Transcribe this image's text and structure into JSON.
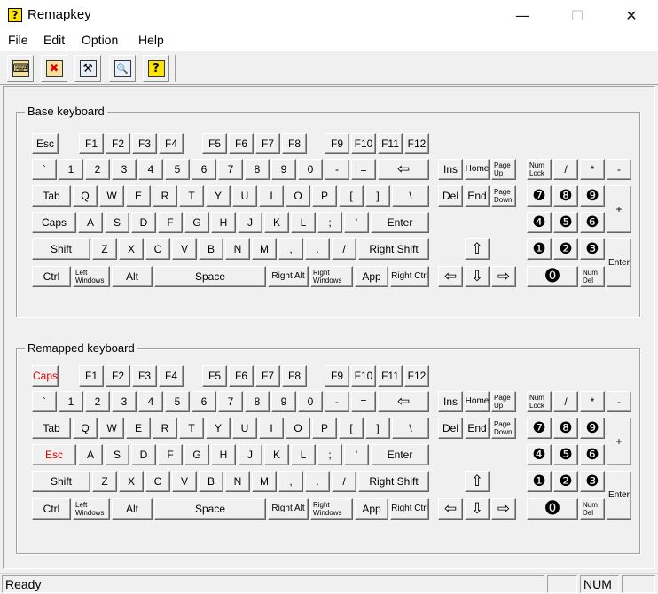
{
  "window": {
    "title": "Remapkey",
    "min": "—",
    "max": "☐",
    "close": "✕"
  },
  "menu": [
    {
      "label": "File"
    },
    {
      "label": "Edit"
    },
    {
      "label": "Option"
    },
    {
      "label": "Help"
    }
  ],
  "toolbar": [
    {
      "icon": "keyboard-icon",
      "glyph": "⌨"
    },
    {
      "icon": "delete-remap-icon",
      "glyph": "✖"
    },
    {
      "icon": "tools-icon",
      "glyph": "⚒"
    },
    {
      "icon": "magnify-icon",
      "glyph": "🔍"
    },
    {
      "icon": "help-icon",
      "glyph": "?"
    }
  ],
  "groups": {
    "base": "Base keyboard",
    "remapped": "Remapped keyboard"
  },
  "base_keys": [
    "Esc",
    "F1",
    "F2",
    "F3",
    "F4",
    "F5",
    "F6",
    "F7",
    "F8",
    "F9",
    "F10",
    "F11",
    "F12",
    "`",
    "1",
    "2",
    "3",
    "4",
    "5",
    "6",
    "7",
    "8",
    "9",
    "0",
    "-",
    "=",
    "⇦",
    "Tab",
    "Q",
    "W",
    "E",
    "R",
    "T",
    "Y",
    "U",
    "I",
    "O",
    "P",
    "[",
    "]",
    "\\",
    "Caps",
    "A",
    "S",
    "D",
    "F",
    "G",
    "H",
    "J",
    "K",
    "L",
    ";",
    "'",
    "Enter",
    "Shift",
    "Z",
    "X",
    "C",
    "V",
    "B",
    "N",
    "M",
    ",",
    ".",
    "/",
    "Right Shift",
    "Ctrl",
    "Left Windows",
    "Alt",
    "Space",
    "Right Alt",
    "Right Windows",
    "App",
    "Right Ctrl",
    "Ins",
    "Home",
    "Page Up",
    "Del",
    "End",
    "Page Down",
    "⇧",
    "⇦",
    "⇩",
    "⇨",
    "Num Lock",
    "/",
    "*",
    "-",
    "❼",
    "❽",
    "❾",
    "+",
    "❹",
    "❺",
    "❻",
    "❶",
    "❷",
    "❸",
    "Enter",
    "⓿",
    "Num Del"
  ],
  "remapped_keys": [
    "Caps",
    "F1",
    "F2",
    "F3",
    "F4",
    "F5",
    "F6",
    "F7",
    "F8",
    "F9",
    "F10",
    "F11",
    "F12",
    "`",
    "1",
    "2",
    "3",
    "4",
    "5",
    "6",
    "7",
    "8",
    "9",
    "0",
    "-",
    "=",
    "⇦",
    "Tab",
    "Q",
    "W",
    "E",
    "R",
    "T",
    "Y",
    "U",
    "I",
    "O",
    "P",
    "[",
    "]",
    "\\",
    "Esc",
    "A",
    "S",
    "D",
    "F",
    "G",
    "H",
    "J",
    "K",
    "L",
    ";",
    "'",
    "Enter",
    "Shift",
    "Z",
    "X",
    "C",
    "V",
    "B",
    "N",
    "M",
    ",",
    ".",
    "/",
    "Right Shift",
    "Ctrl",
    "Left Windows",
    "Alt",
    "Space",
    "Right Alt",
    "Right Windows",
    "App",
    "Right Ctrl",
    "Ins",
    "Home",
    "Page Up",
    "Del",
    "End",
    "Page Down",
    "⇧",
    "⇦",
    "⇩",
    "⇨",
    "Num Lock",
    "/",
    "*",
    "-",
    "❼",
    "❽",
    "❾",
    "+",
    "❹",
    "❺",
    "❻",
    "❶",
    "❷",
    "❸",
    "Enter",
    "⓿",
    "Num Del"
  ],
  "remapped_highlight_color": "#e00000",
  "status": {
    "text": "Ready",
    "num": "NUM"
  }
}
